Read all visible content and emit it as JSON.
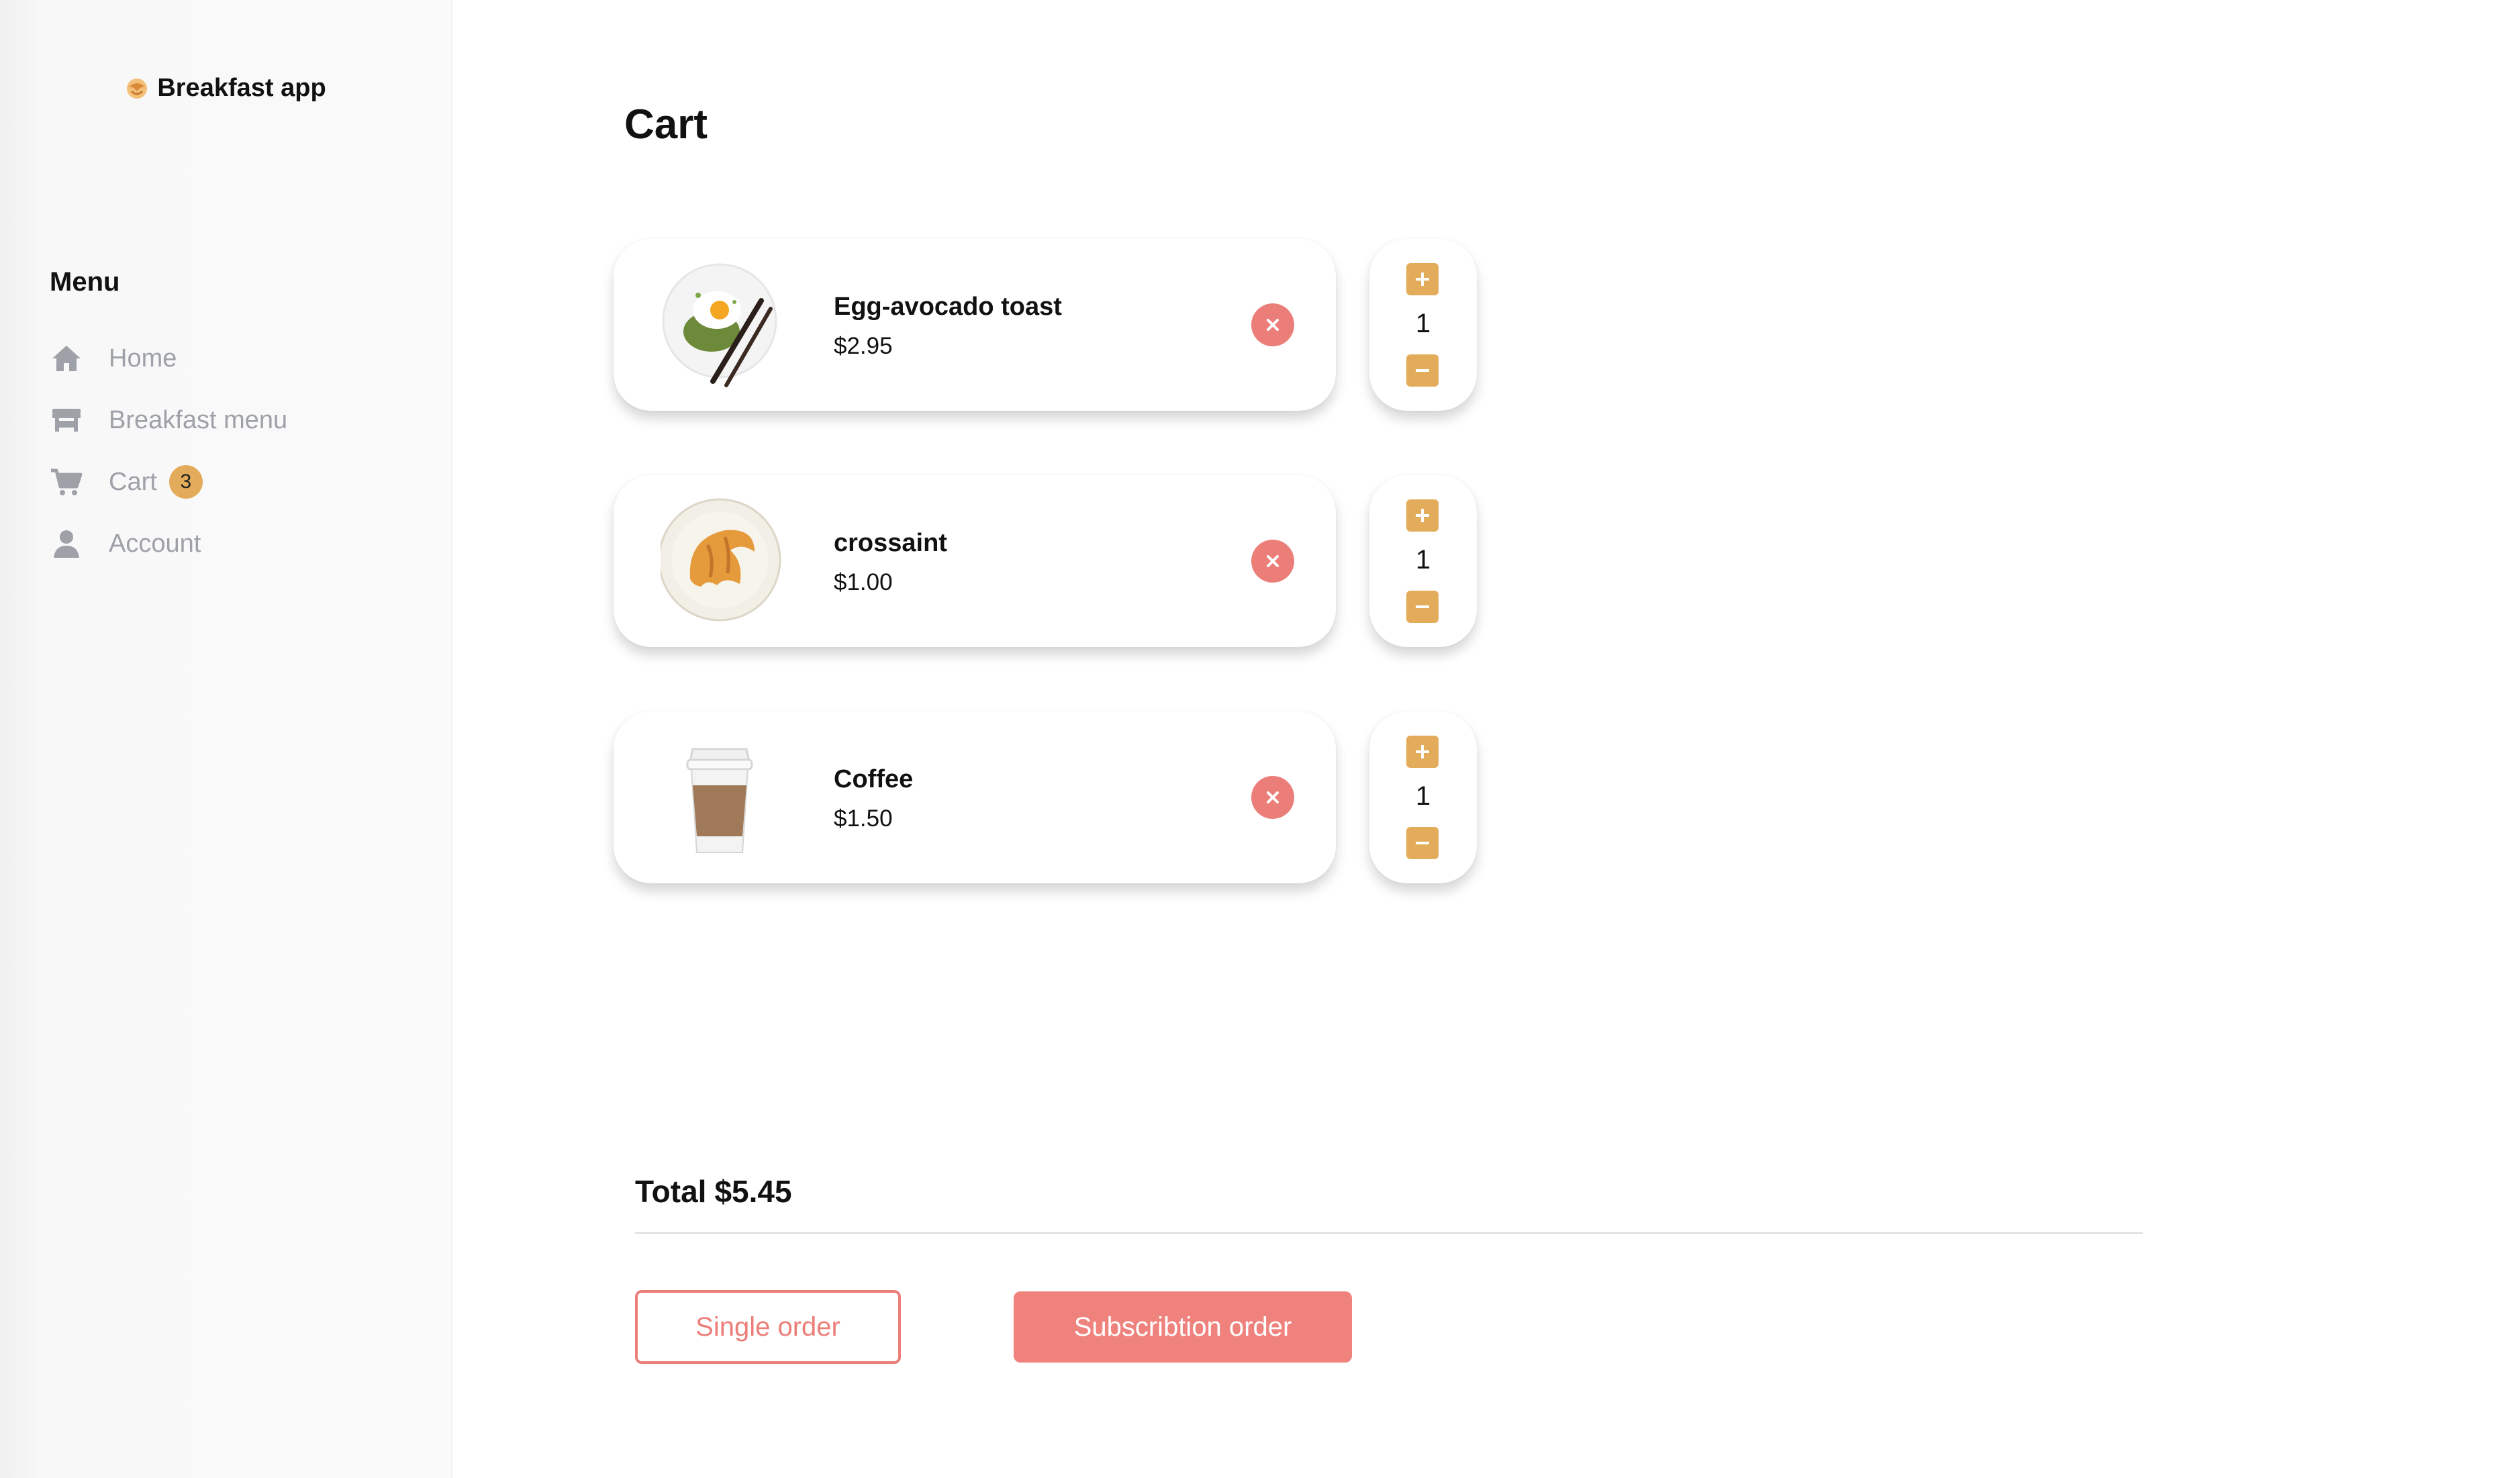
{
  "app": {
    "title": "Breakfast app",
    "brand_icon": "croissant-icon"
  },
  "sidebar": {
    "menu_title": "Menu",
    "items": [
      {
        "label": "Home",
        "icon": "home-icon"
      },
      {
        "label": "Breakfast menu",
        "icon": "store-icon"
      },
      {
        "label": "Cart",
        "icon": "cart-icon",
        "badge": "3"
      },
      {
        "label": "Account",
        "icon": "user-icon"
      }
    ]
  },
  "main": {
    "title": "Cart",
    "items": [
      {
        "name": "Egg-avocado toast",
        "price": "$2.95",
        "qty": "1",
        "image": "egg-avocado-toast-image"
      },
      {
        "name": "crossaint",
        "price": "$1.00",
        "qty": "1",
        "image": "croissant-image"
      },
      {
        "name": "Coffee",
        "price": "$1.50",
        "qty": "1",
        "image": "coffee-cup-image"
      }
    ],
    "total_label": "Total",
    "total_value": "$5.45",
    "single_order_label": "Single order",
    "subscription_order_label": "Subscribtion order"
  },
  "colors": {
    "accent": "#e3ac5b",
    "danger": "#ec7e79",
    "nav_text": "#9ea1a8"
  }
}
